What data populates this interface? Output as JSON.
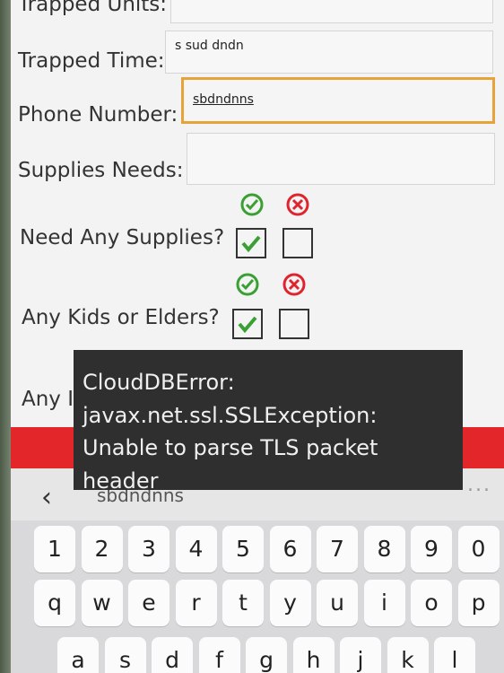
{
  "form": {
    "trapped_units_label": "Trapped Units:",
    "trapped_time_label": "Trapped Time:",
    "trapped_time_value": "s sud dndn",
    "phone_label": "Phone Number:",
    "phone_value": "sbdndnns",
    "supplies_needs_label": "Supplies Needs:",
    "need_supplies_label": "Need Any Supplies?",
    "kids_elders_label": "Any Kids or Elders?",
    "partial_label": "Any I",
    "need_supplies_checked": true,
    "kids_elders_checked": true
  },
  "colors": {
    "accent_focus": "#e8a23a",
    "check_green": "#3aa033",
    "cross_red": "#e0242e",
    "error_bar": "#e2262a"
  },
  "icons": {
    "yes": "check-circle-icon",
    "no": "x-circle-icon",
    "checked": "checkmark-icon"
  },
  "toast": {
    "lines": [
      "CloudDBError:",
      "javax.net.ssl.SSLException:",
      "Unable to parse TLS packet",
      "header"
    ]
  },
  "keyboard": {
    "suggestion": "sbdndnns",
    "back_icon": "chevron-left-icon",
    "more_label": "...",
    "row_numbers": [
      "1",
      "2",
      "3",
      "4",
      "5",
      "6",
      "7",
      "8",
      "9",
      "0"
    ],
    "row_top": [
      "q",
      "w",
      "e",
      "r",
      "t",
      "y",
      "u",
      "i",
      "o",
      "p"
    ],
    "row_mid": [
      "a",
      "s",
      "d",
      "f",
      "g",
      "h",
      "j",
      "k",
      "l"
    ]
  }
}
